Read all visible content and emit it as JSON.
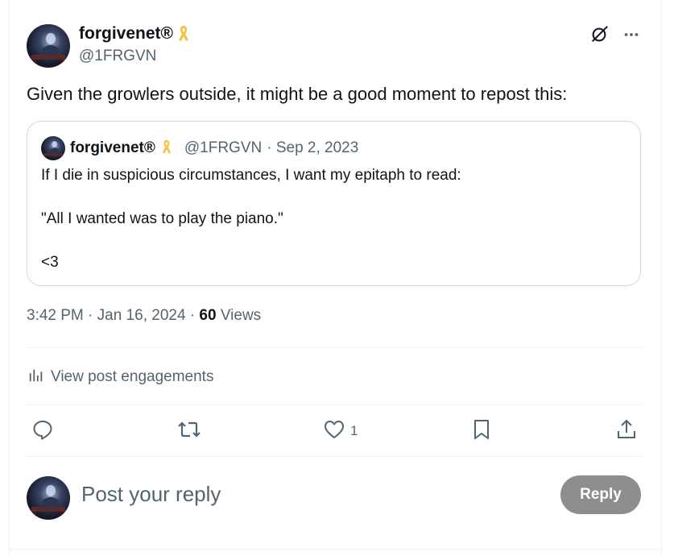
{
  "post": {
    "author_name": "forgivenet®",
    "author_handle": "@1FRGVN",
    "text": "Given the growlers outside, it might be a good moment to repost this:",
    "timestamp": "3:42 PM · Jan 16, 2024",
    "views_count": "60",
    "views_label": "Views",
    "ribbon_color": "#f5c542"
  },
  "quote": {
    "author_name": "forgivenet®",
    "author_handle": "@1FRGVN",
    "date": "· Sep 2, 2023",
    "line1": "If I die in suspicious circumstances, I want my epitaph to read:",
    "line2": "\"All I wanted was to play the piano.\"",
    "line3": "<3"
  },
  "engagements": {
    "label": "View post engagements"
  },
  "actions": {
    "like_count": "1"
  },
  "reply": {
    "placeholder": "Post your reply",
    "button_label": "Reply",
    "button_color": "#8b8d8f"
  },
  "colors": {
    "text": "#0f1419",
    "secondary": "#536471",
    "border": "#cfd9de"
  }
}
